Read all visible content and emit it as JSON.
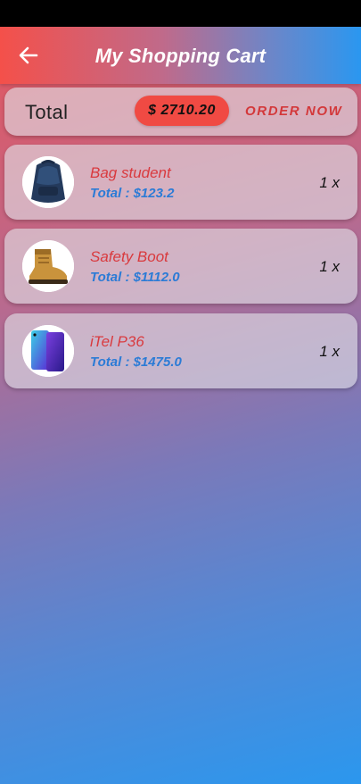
{
  "app_bar": {
    "title": "My Shopping Cart",
    "back_icon": "arrow-left-icon"
  },
  "summary": {
    "total_label": "Total",
    "total_value": "$ 2710.20",
    "order_label": "ORDER NOW"
  },
  "items": [
    {
      "name": "Bag student",
      "total": "Total : $123.2",
      "qty": "1 x",
      "icon": "backpack-image"
    },
    {
      "name": "Safety Boot",
      "total": "Total : $1112.0",
      "qty": "1 x",
      "icon": "boot-image"
    },
    {
      "name": "iTel P36",
      "total": "Total : $1475.0",
      "qty": "1 x",
      "icon": "phone-image"
    }
  ],
  "colors": {
    "accent_red": "#f04a43",
    "item_name": "#d93a3e",
    "item_total": "#2b7bd6",
    "gradient_top": "#e9545a",
    "gradient_bottom": "#2b97ee"
  }
}
